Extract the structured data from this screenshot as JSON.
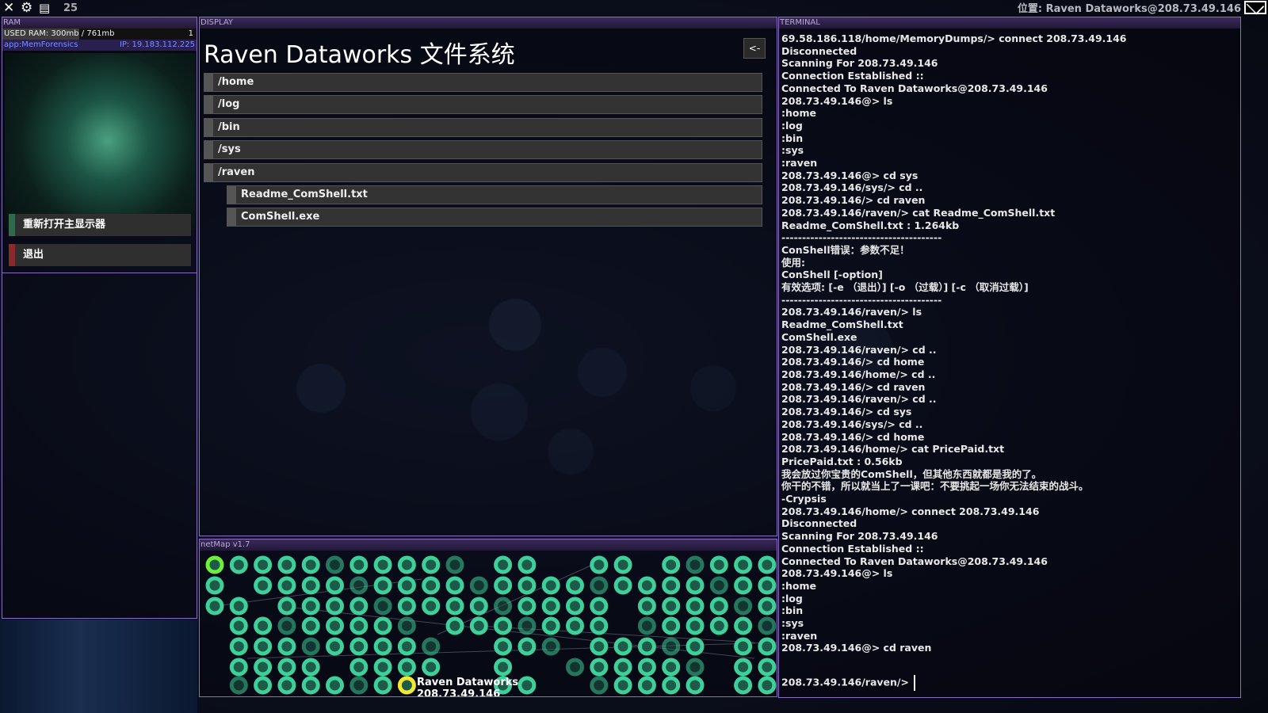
{
  "topbar": {
    "close_icon": "x-icon",
    "settings_icon": "gear-icon",
    "save_icon": "floppy-icon",
    "count": "25",
    "location": "位置: Raven Dataworks@208.73.49.146",
    "mail_icon": "envelope-icon"
  },
  "ram": {
    "header": "RAM",
    "used": "USED RAM: 300mb / 761mb",
    "used_fraction": 0.394,
    "slot_count": "1",
    "app": "app:MemForensics",
    "ip": "IP: 19.183.112.225",
    "reopen_label": "重新打开主显示器",
    "exit_label": "退出",
    "reopen_color": "#2f6a4a",
    "exit_color": "#8a2a2a"
  },
  "display": {
    "header": "DISPLAY",
    "title": "Raven Dataworks 文件系统",
    "back_label": "<-",
    "folders": [
      "/home",
      "/log",
      "/bin",
      "/sys",
      "/raven"
    ],
    "files": [
      "Readme_ComShell.txt",
      "ComShell.exe"
    ]
  },
  "netmap": {
    "header": "netMap v1.7",
    "node_label": "Raven Dataworks",
    "node_ip": "208.73.49.146",
    "node_color": "#3ecf9a",
    "selected_color": "#f2e830",
    "home_color": "#6ef03a"
  },
  "terminal": {
    "header": "TERMINAL",
    "lines": [
      "69.58.186.118/home/MemoryDumps/> connect 208.73.49.146",
      "Disconnected",
      "Scanning For 208.73.49.146",
      "Connection Established ::",
      "Connected To Raven Dataworks@208.73.49.146",
      "208.73.49.146@> ls",
      ":home",
      ":log",
      ":bin",
      ":sys",
      ":raven",
      "208.73.49.146@> cd sys",
      "208.73.49.146/sys/> cd ..",
      "208.73.49.146/> cd raven",
      "208.73.49.146/raven/> cat Readme_ComShell.txt",
      "Readme_ComShell.txt : 1.264kb",
      "---------------------------------------",
      "ConShell错误：参数不足！",
      "使用:",
      "ConShell [-option]",
      "有效选项: [-e （退出）] [-o （过载）] [-c （取消过载）]",
      "---------------------------------------",
      "208.73.49.146/raven/> ls",
      "Readme_ComShell.txt",
      "ComShell.exe",
      "208.73.49.146/raven/> cd ..",
      "208.73.49.146/> cd home",
      "208.73.49.146/home/> cd ..",
      "208.73.49.146/> cd raven",
      "208.73.49.146/raven/> cd ..",
      "208.73.49.146/> cd sys",
      "208.73.49.146/sys/> cd ..",
      "208.73.49.146/> cd home",
      "208.73.49.146/home/> cat PricePaid.txt",
      "PricePaid.txt : 0.56kb",
      "我会放过你宝贵的ComShell，但其他东西就都是我的了。",
      "你干的不错，所以就当上了一课吧：不要挑起一场你无法结束的战斗。",
      "-Crypsis",
      "208.73.49.146/home/> connect 208.73.49.146",
      "Disconnected",
      "Scanning For 208.73.49.146",
      "Connection Established ::",
      "Connected To Raven Dataworks@208.73.49.146",
      "208.73.49.146@> ls",
      ":home",
      ":log",
      ":bin",
      ":sys",
      ":raven",
      "208.73.49.146@> cd raven"
    ],
    "prompt": "208.73.49.146/raven/>"
  }
}
